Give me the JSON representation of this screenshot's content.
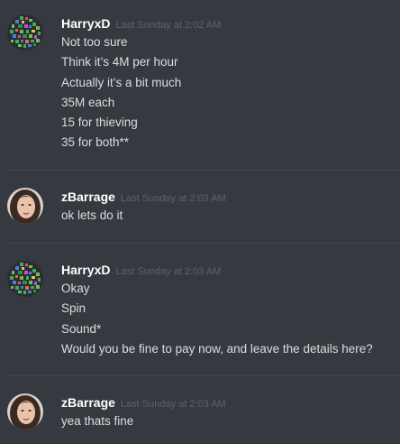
{
  "colors": {
    "background": "#36393f",
    "username": "#ffffff",
    "timestamp": "#5f6268",
    "message_text": "#dcddde",
    "divider": "#42454b"
  },
  "groups": [
    {
      "username": "HarryxD",
      "timestamp": "Last Sunday at 2:02 AM",
      "avatar_icon": "pixel-art-avatar-icon",
      "messages": [
        "Not too sure",
        "Think it’s 4M per hour",
        "Actually it’s a bit much",
        "35M each",
        "15 for thieving",
        "35 for both**"
      ]
    },
    {
      "username": "zBarrage",
      "timestamp": "Last Sunday at 2:03 AM",
      "avatar_icon": "face-avatar-icon",
      "messages": [
        "ok lets do it"
      ]
    },
    {
      "username": "HarryxD",
      "timestamp": "Last Sunday at 2:03 AM",
      "avatar_icon": "pixel-art-avatar-icon",
      "messages": [
        "Okay",
        "Spin",
        "Sound*",
        "Would you be fine to pay now, and leave the details here?"
      ]
    },
    {
      "username": "zBarrage",
      "timestamp": "Last Sunday at 2:03 AM",
      "avatar_icon": "face-avatar-icon",
      "messages": [
        "yea thats fine"
      ]
    }
  ]
}
